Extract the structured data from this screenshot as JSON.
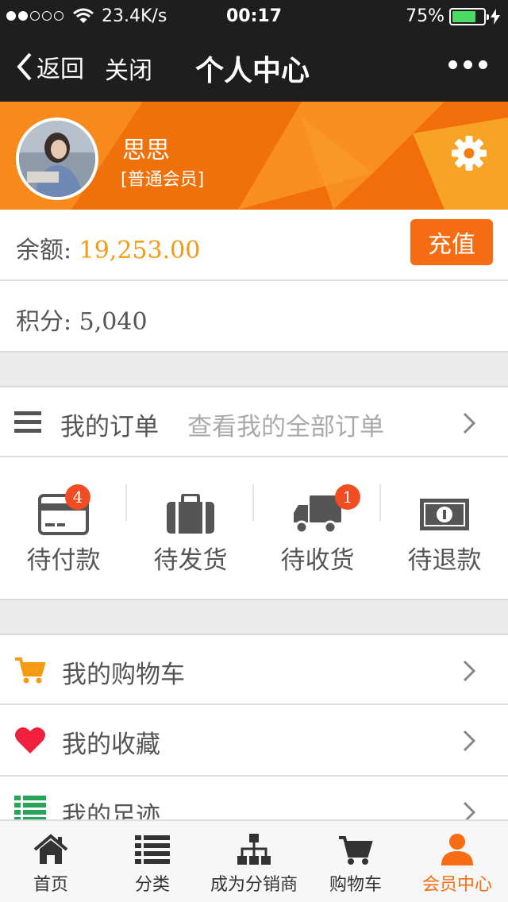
{
  "status_bar": {
    "network_speed": "23.4K/s",
    "time": "00:17",
    "battery_percent": "75%",
    "battery_level": 0.75
  },
  "navbar": {
    "back_label": "返回",
    "close_label": "关闭",
    "title": "个人中心"
  },
  "profile": {
    "username": "思思",
    "level": "[普通会员]"
  },
  "balance": {
    "label": "余额: ",
    "value": "19,253.00",
    "recharge_label": "充值"
  },
  "points": {
    "label": "积分: 5,040"
  },
  "orders": {
    "title": "我的订单",
    "hint": "查看我的全部订单",
    "statuses": [
      {
        "label": "待付款",
        "badge": "4"
      },
      {
        "label": "待发货"
      },
      {
        "label": "待收货",
        "badge": "1"
      },
      {
        "label": "待退款"
      }
    ]
  },
  "menu": [
    {
      "label": "我的购物车"
    },
    {
      "label": "我的收藏"
    },
    {
      "label": "我的足迹"
    }
  ],
  "tabbar": [
    {
      "label": "首页",
      "icon": "home-icon"
    },
    {
      "label": "分类",
      "icon": "list-icon"
    },
    {
      "label": "成为分销商",
      "icon": "org-chart-icon"
    },
    {
      "label": "购物车",
      "icon": "cart-icon"
    },
    {
      "label": "会员中心",
      "icon": "user-icon",
      "active": true
    }
  ],
  "colors": {
    "accent": "#f56c12",
    "balance_value": "#f39a14",
    "badge": "#f24d22",
    "favorite": "#f0203e",
    "footprint": "#27a35a",
    "cart": "#f59a11"
  }
}
